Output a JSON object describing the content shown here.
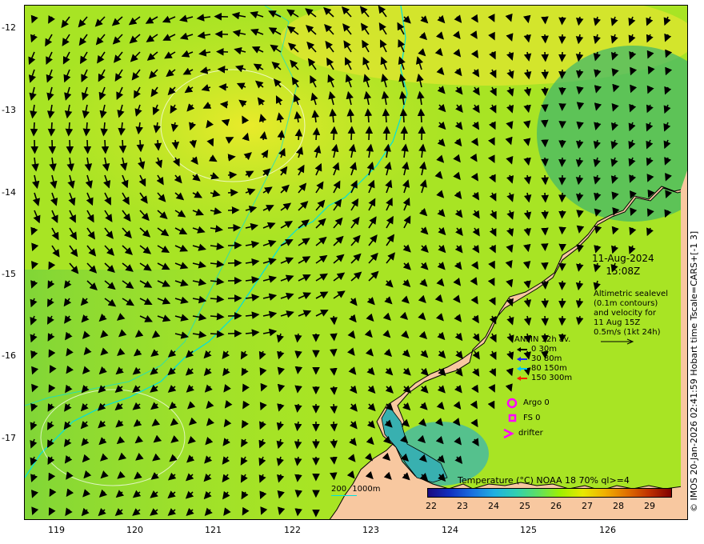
{
  "map": {
    "y_ticks": [
      "-12",
      "-13",
      "-14",
      "-15",
      "-16",
      "-17"
    ],
    "x_ticks": [
      "119",
      "120",
      "121",
      "122",
      "123",
      "124",
      "125",
      "126"
    ],
    "date": "11-Aug-2024",
    "time": "15:08Z",
    "altimetry_note": [
      "Altimetric sealevel",
      "(0.1m contours)",
      "and velocity for",
      "11 Aug 15Z",
      "0.5m/s (1kt 24h)"
    ],
    "anmn": {
      "title": "ANMN 12h av.",
      "rows": [
        {
          "label": "0 30m",
          "color": "#000000"
        },
        {
          "label": "30 80m",
          "color": "#2020ff"
        },
        {
          "label": "80 150m",
          "color": "#00c8ff"
        },
        {
          "label": "150 300m",
          "color": "#ff2000"
        }
      ]
    },
    "markers": [
      {
        "label": "Argo 0",
        "color": "#ff00ff",
        "icon": "circle-icon"
      },
      {
        "label": "FS 0",
        "color": "#ff00ff",
        "icon": "square-icon"
      },
      {
        "label": "drifter",
        "color": "#ff00ff",
        "icon": "chevron-icon"
      }
    ],
    "depth_legend": [
      "200",
      "1000m"
    ],
    "colorbar": {
      "title": "Temperature (°C) NOAA 18 70% ql>=4",
      "labels": [
        "22",
        "23",
        "24",
        "25",
        "26",
        "27",
        "28",
        "29"
      ]
    },
    "credit": "© IMOS 20-Jan-2026 02:41:59 Hobart time Tscale=CARS+[-1 3]",
    "colors": {
      "land": "#f8c8a0",
      "sea": "#b0e820",
      "warm": "#e6ea30",
      "cool": "#50c060",
      "shelf_edge": "#00e0e0"
    }
  }
}
